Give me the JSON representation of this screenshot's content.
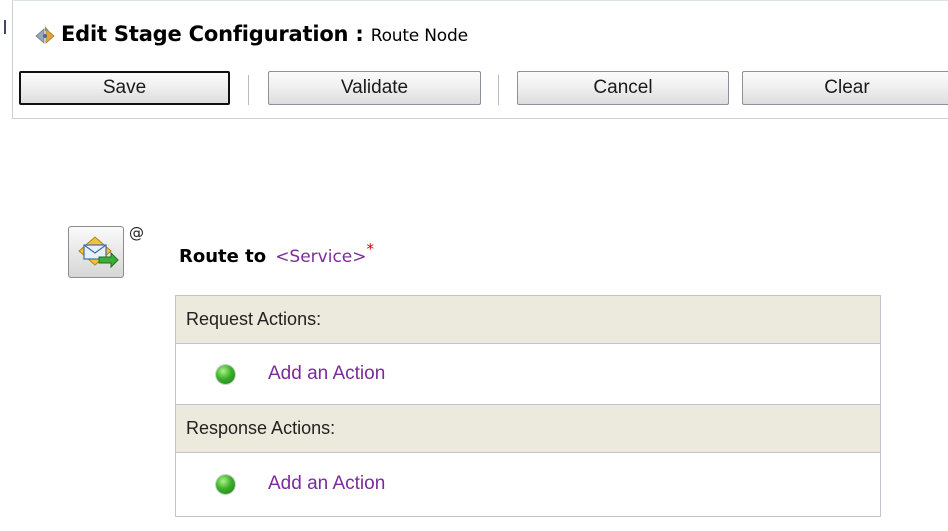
{
  "header": {
    "title": "Edit Stage Configuration",
    "separator": " : ",
    "subtitle": "Route Node"
  },
  "toolbar": {
    "save_label": "Save",
    "validate_label": "Validate",
    "cancel_label": "Cancel",
    "clear_label": "Clear"
  },
  "node": {
    "icon": "route-node-icon",
    "at_symbol": "@",
    "route_label": "Route to",
    "service_placeholder": "<Service>",
    "required_marker": "*"
  },
  "request": {
    "header": "Request Actions:",
    "add_action_label": "Add an Action"
  },
  "response": {
    "header": "Response Actions:",
    "add_action_label": "Add an Action"
  },
  "colors": {
    "link": "#7a2c9a",
    "required": "#cc0000",
    "section_header_bg": "#ece9dd",
    "action_dot": "#3bb12a"
  }
}
